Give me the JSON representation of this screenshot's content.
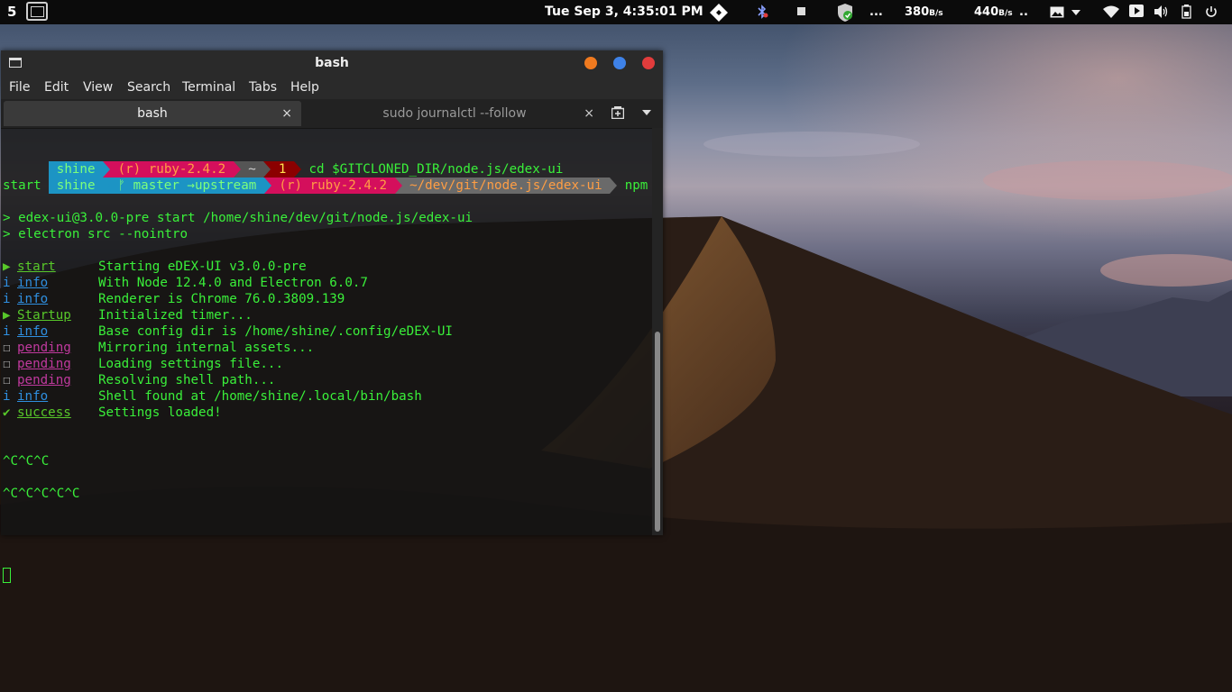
{
  "top_panel": {
    "workspace": "5",
    "clock": "Tue Sep  3, 4:35:01 PM",
    "net_down_value": "380",
    "net_down_unit": "B/s",
    "net_up_value": "440",
    "net_up_unit": "B/s",
    "dots": "...",
    "dots2": ".."
  },
  "window": {
    "title": "bash",
    "menu": [
      "File",
      "Edit",
      "View",
      "Search",
      "Terminal",
      "Tabs",
      "Help"
    ],
    "tabs": [
      {
        "label": "bash",
        "close": "×",
        "active": true
      },
      {
        "label": "sudo journalctl --follow",
        "close": "×",
        "active": false
      }
    ]
  },
  "terminal": {
    "prompt1": {
      "user": " shine ",
      "ruby": " (r) ruby-2.4.2 ",
      "dir": " ~ ",
      "status": " 1 ",
      "command": " cd $GITCLONED_DIR/node.js/edex-ui"
    },
    "prompt2": {
      "user": " shine ",
      "git": " ᚠ master →upstream ",
      "ruby": " (r) ruby-2.4.2 ",
      "dir": " ~/dev/git/node.js/edex-ui ",
      "command": " npm"
    },
    "wrap": "start",
    "npm_lines": [
      "> edex-ui@3.0.0-pre start /home/shine/dev/git/node.js/edex-ui",
      "> electron src --nointro"
    ],
    "log": [
      {
        "icon": "▶",
        "level": "start",
        "msg": "Starting eDEX-UI v3.0.0-pre",
        "kind": "start"
      },
      {
        "icon": "i",
        "level": "info",
        "msg": "With Node 12.4.0 and Electron 6.0.7",
        "kind": "info"
      },
      {
        "icon": "i",
        "level": "info",
        "msg": "Renderer is Chrome 76.0.3809.139",
        "kind": "info"
      },
      {
        "icon": "▶",
        "level": "Startup",
        "msg": "Initialized timer...",
        "kind": "start"
      },
      {
        "icon": "i",
        "level": "info",
        "msg": "Base config dir is /home/shine/.config/eDEX-UI",
        "kind": "info"
      },
      {
        "icon": "☐",
        "level": "pending",
        "msg": "Mirroring internal assets...",
        "kind": "pending"
      },
      {
        "icon": "☐",
        "level": "pending",
        "msg": "Loading settings file...",
        "kind": "pending"
      },
      {
        "icon": "☐",
        "level": "pending",
        "msg": "Resolving shell path...",
        "kind": "pending"
      },
      {
        "icon": "i",
        "level": "info",
        "msg": "Shell found at /home/shine/.local/bin/bash",
        "kind": "info"
      },
      {
        "icon": "✔",
        "level": "success",
        "msg": "Settings loaded!",
        "kind": "success"
      }
    ],
    "ctrl_c_1": "^C^C^C",
    "ctrl_c_2": "^C^C^C^C^C"
  },
  "colors": {
    "terminal_text": "#3af03a",
    "powerline_blue": "#1c94c4",
    "powerline_pink": "#d40f5c",
    "close_button": "#e23c3c",
    "minimize_button": "#f07a1f",
    "maximize_button": "#3e82e8"
  }
}
